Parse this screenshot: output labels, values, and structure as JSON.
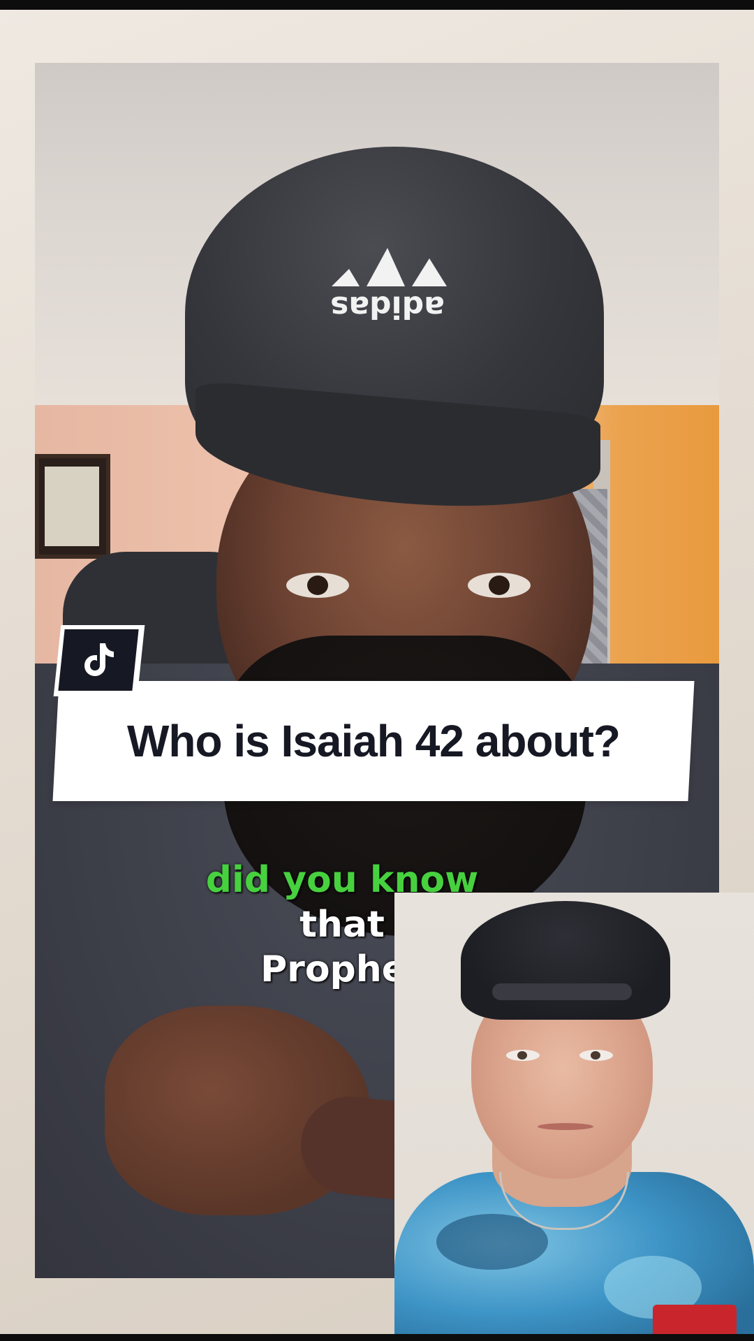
{
  "video": {
    "caption_lines": [
      "did you know",
      "that",
      "Prophet"
    ],
    "caption_highlight_color": "#47d13f",
    "cap_brand_text": "adidas"
  },
  "title_banner": {
    "text": "Who is Isaiah 42 about?",
    "icon": "tiktok-logo-icon"
  },
  "colors": {
    "banner_background": "#ffffff",
    "banner_text": "#161823",
    "badge_background": "#161823"
  }
}
